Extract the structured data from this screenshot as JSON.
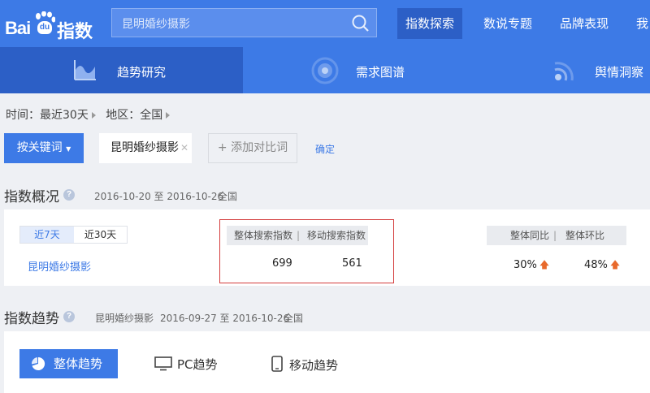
{
  "header": {
    "logo_text_bai": "Bai",
    "logo_text_du": "du",
    "logo_text_product": "指数",
    "search_value": "昆明婚纱摄影",
    "nav": [
      "指数探索",
      "数说专题",
      "品牌表现",
      "我"
    ]
  },
  "subnav": {
    "tabs": [
      "趋势研究",
      "需求图谱",
      "舆情洞察"
    ]
  },
  "filters": {
    "time_label": "时间：最近30天",
    "region_label": "地区：全国"
  },
  "keywords": {
    "button_label": "按关键词",
    "current_keyword": "昆明婚纱摄影",
    "add_compare_label": "添加对比词",
    "confirm_label": "确定"
  },
  "overview": {
    "title": "指数概况",
    "date_range": "2016-10-20 至 2016-10-26",
    "region": "全国",
    "periods": [
      "近7天",
      "近30天"
    ],
    "keyword_link": "昆明婚纱摄影",
    "col_overall": "整体搜索指数",
    "col_mobile": "移动搜索指数",
    "overall_value": "699",
    "mobile_value": "561",
    "col_yoy": "整体同比",
    "col_mom": "整体环比",
    "yoy_value": "30%",
    "mom_value": "48%",
    "separator": "|"
  },
  "trend": {
    "title": "指数趋势",
    "keyword": "昆明婚纱摄影",
    "date_range": "2016-09-27 至 2016-10-26",
    "region": "全国",
    "options": [
      "整体趋势",
      "PC趋势",
      "移动趋势"
    ]
  },
  "colors": {
    "brand": "#3d7ae6",
    "brand_dark": "#2c5fc6",
    "highlight_frame": "#d43c3c",
    "up_arrow": "#e8692b"
  }
}
